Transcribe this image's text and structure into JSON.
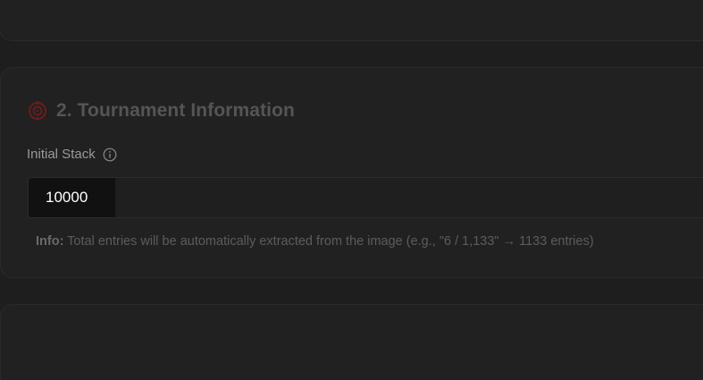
{
  "section": {
    "number_title": "2. Tournament Information",
    "icon": "target-icon",
    "accent_color": "#7a1f1f"
  },
  "initial_stack": {
    "label": "Initial Stack",
    "help_icon": "info-icon",
    "value": "10000"
  },
  "info_note": {
    "prefix": "Info:",
    "text": " Total entries will be automatically extracted from the image (e.g., \"6 / 1,133\" → 1133 entries)"
  }
}
